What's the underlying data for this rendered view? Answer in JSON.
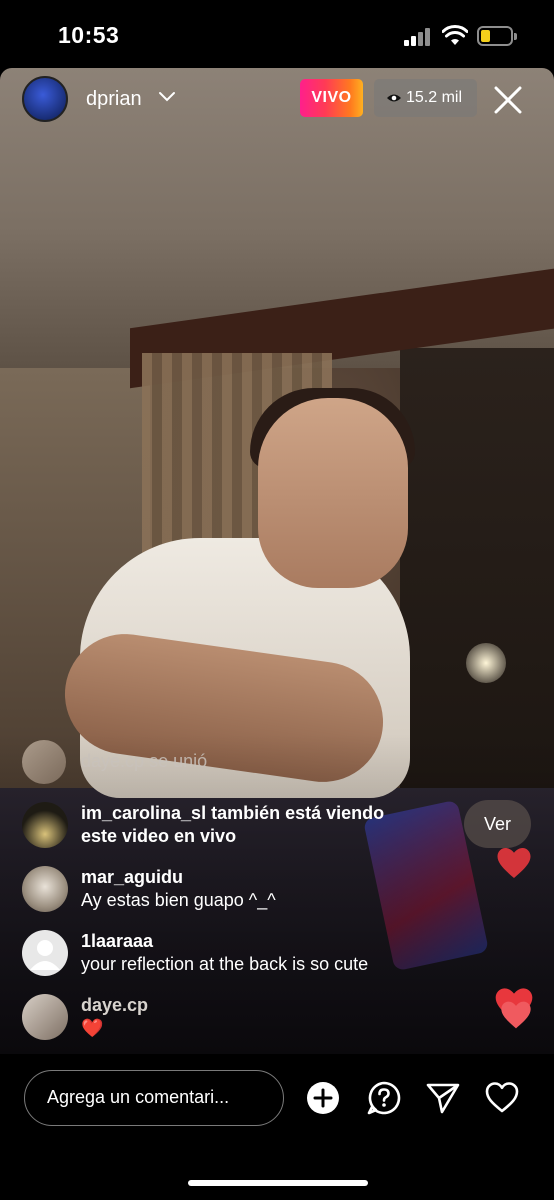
{
  "status_bar": {
    "time": "10:53"
  },
  "live": {
    "host_name": "dprian",
    "live_badge": "VIVO",
    "viewer_count": "15.2 mil"
  },
  "comments": [
    {
      "user": "daye.cp",
      "text": "se unió",
      "type": "join",
      "avatar": "photo-avatar"
    },
    {
      "user": "im_carolina_sl",
      "text": "también está viendo este video en vivo",
      "type": "watching",
      "avatar": "photo-avatar"
    },
    {
      "user": "mar_aguidu",
      "text": "Ay estas bien guapo ^_^",
      "type": "comment",
      "avatar": "cat-avatar"
    },
    {
      "user": "1laaraaa",
      "text": "your reflection at the back is so cute",
      "type": "comment",
      "avatar": "default-avatar"
    },
    {
      "user": "daye.cp",
      "text": "❤️",
      "type": "comment",
      "avatar": "photo-avatar"
    }
  ],
  "ver_button": "Ver",
  "bottom_bar": {
    "comment_placeholder": "Agrega un comentari...",
    "icons": [
      "add-icon",
      "question-icon",
      "send-icon",
      "heart-icon"
    ]
  },
  "colors": {
    "live_badge_gradient_start": "#ff1f8c",
    "live_badge_gradient_end": "#ffb020",
    "heart_red": "#e8373d",
    "battery_yellow": "#f4d01b"
  }
}
